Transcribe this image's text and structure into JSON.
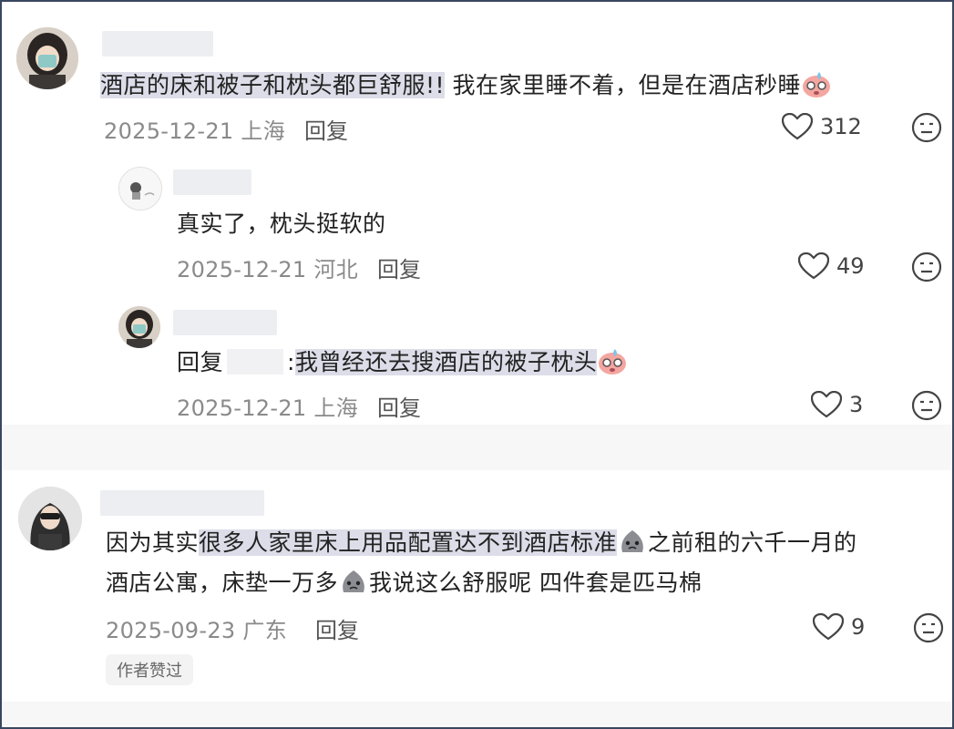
{
  "comments": [
    {
      "text_highlight": "酒店的床和被子和枕头都巨舒服!!",
      "text_rest": "我在家里睡不着，但是在酒店秒睡",
      "date": "2025-12-21",
      "location": "上海",
      "reply_label": "回复",
      "likes": "312",
      "replies": [
        {
          "text": "真实了，枕头挺软的",
          "date": "2025-12-21",
          "location": "河北",
          "reply_label": "回复",
          "likes": "49"
        },
        {
          "reply_prefix": "回复",
          "reply_target_tail": ":",
          "text_highlight": "我曾经还去搜酒店的被子枕头",
          "date": "2025-12-21",
          "location": "上海",
          "reply_label": "回复",
          "likes": "3"
        }
      ]
    },
    {
      "line1_plain": "因为其实",
      "line1_highlight": "很多人家里床上用品配置达不到酒店标准",
      "line1_rest": "之前租的六千一月的",
      "line2_a": "酒店公寓，床垫一万多",
      "line2_b": "我说这么舒服呢 四件套是匹马棉",
      "date": "2025-09-23",
      "location": "广东",
      "reply_label": "回复",
      "likes": "9",
      "badge": "作者赞过"
    }
  ],
  "colors": {
    "highlight": "#dcdde8",
    "meta": "#8a8a8a",
    "border": "#3a4660"
  }
}
